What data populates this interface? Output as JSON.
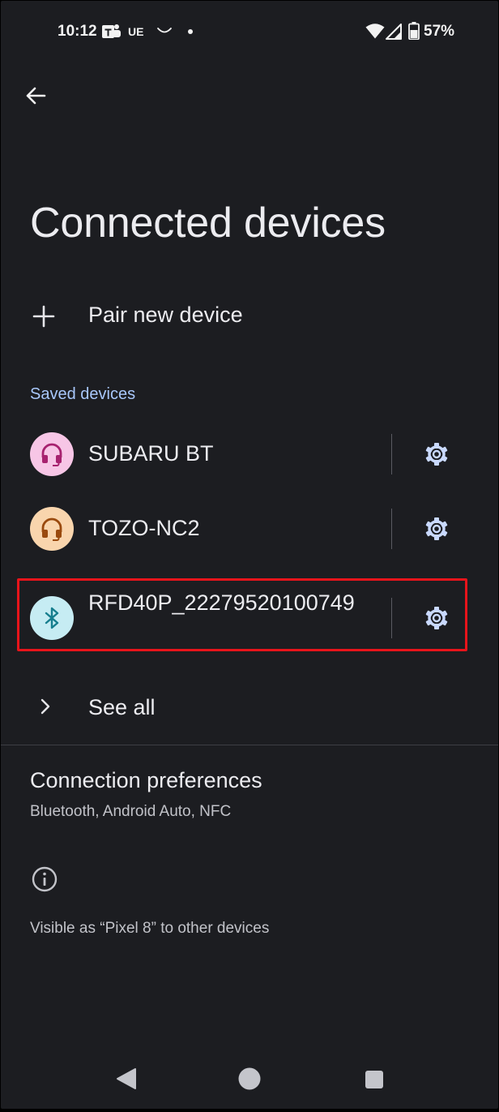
{
  "status_bar": {
    "time": "10:12",
    "carrier_badge": "UE",
    "battery": "57%"
  },
  "header": {
    "title": "Connected devices"
  },
  "pair_new": {
    "label": "Pair new device"
  },
  "saved_devices": {
    "section_label": "Saved devices",
    "items": [
      {
        "name": "SUBARU BT",
        "icon": "headset-icon",
        "avatar_bg": "#f7c6e6",
        "icon_color": "#a7226f"
      },
      {
        "name": "TOZO-NC2",
        "icon": "headset-icon",
        "avatar_bg": "#f9d5ad",
        "icon_color": "#9a4a0e"
      },
      {
        "name": "RFD40P_22279520100749",
        "icon": "bluetooth-icon",
        "avatar_bg": "#c6ecf3",
        "icon_color": "#167e8e"
      }
    ]
  },
  "see_all": {
    "label": "See all"
  },
  "connection_preferences": {
    "title": "Connection preferences",
    "summary": "Bluetooth, Android Auto, NFC"
  },
  "footer": {
    "visible_as": "Visible as “Pixel 8” to other devices"
  },
  "colors": {
    "background": "#1c1d21",
    "accent": "#a8c7fa",
    "highlight": "#e8141b"
  }
}
